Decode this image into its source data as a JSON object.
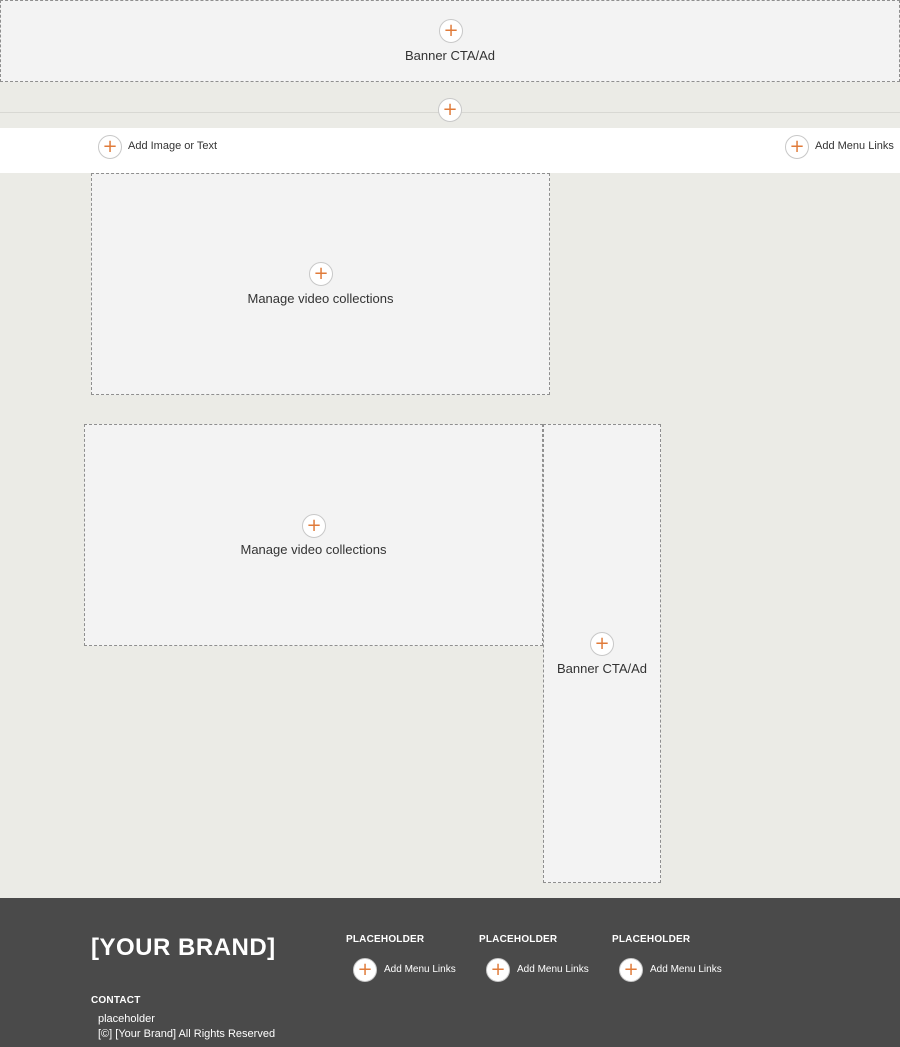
{
  "top_banner": {
    "label": "Banner CTA/Ad",
    "add_symbol": "+"
  },
  "section_add": {
    "add_symbol": "+"
  },
  "header": {
    "left": {
      "label": "Add Image or Text",
      "add_symbol": "+"
    },
    "right": {
      "label": "Add Menu Links",
      "add_symbol": "+"
    }
  },
  "video_collection_1": {
    "label": "Manage video collections",
    "add_symbol": "+"
  },
  "video_collection_2": {
    "label": "Manage video collections",
    "add_symbol": "+"
  },
  "side_banner": {
    "label": "Banner CTA/Ad",
    "add_symbol": "+"
  },
  "footer": {
    "brand": "[YOUR BRAND]",
    "columns": [
      {
        "heading": "PLACEHOLDER",
        "menu_label": "Add Menu Links",
        "add_symbol": "+"
      },
      {
        "heading": "PLACEHOLDER",
        "menu_label": "Add Menu Links",
        "add_symbol": "+"
      },
      {
        "heading": "PLACEHOLDER",
        "menu_label": "Add Menu Links",
        "add_symbol": "+"
      }
    ],
    "contact_heading": "CONTACT",
    "contact_text": "placeholder",
    "copyright": "[©] [Your Brand] All Rights Reserved"
  },
  "colors": {
    "page_background": "#ebebe6",
    "placeholder_fill": "#f3f3f3",
    "accent_plus": "#e07b3a",
    "footer_background": "#4a4a4a"
  },
  "icons": {
    "add": "plus-icon"
  }
}
